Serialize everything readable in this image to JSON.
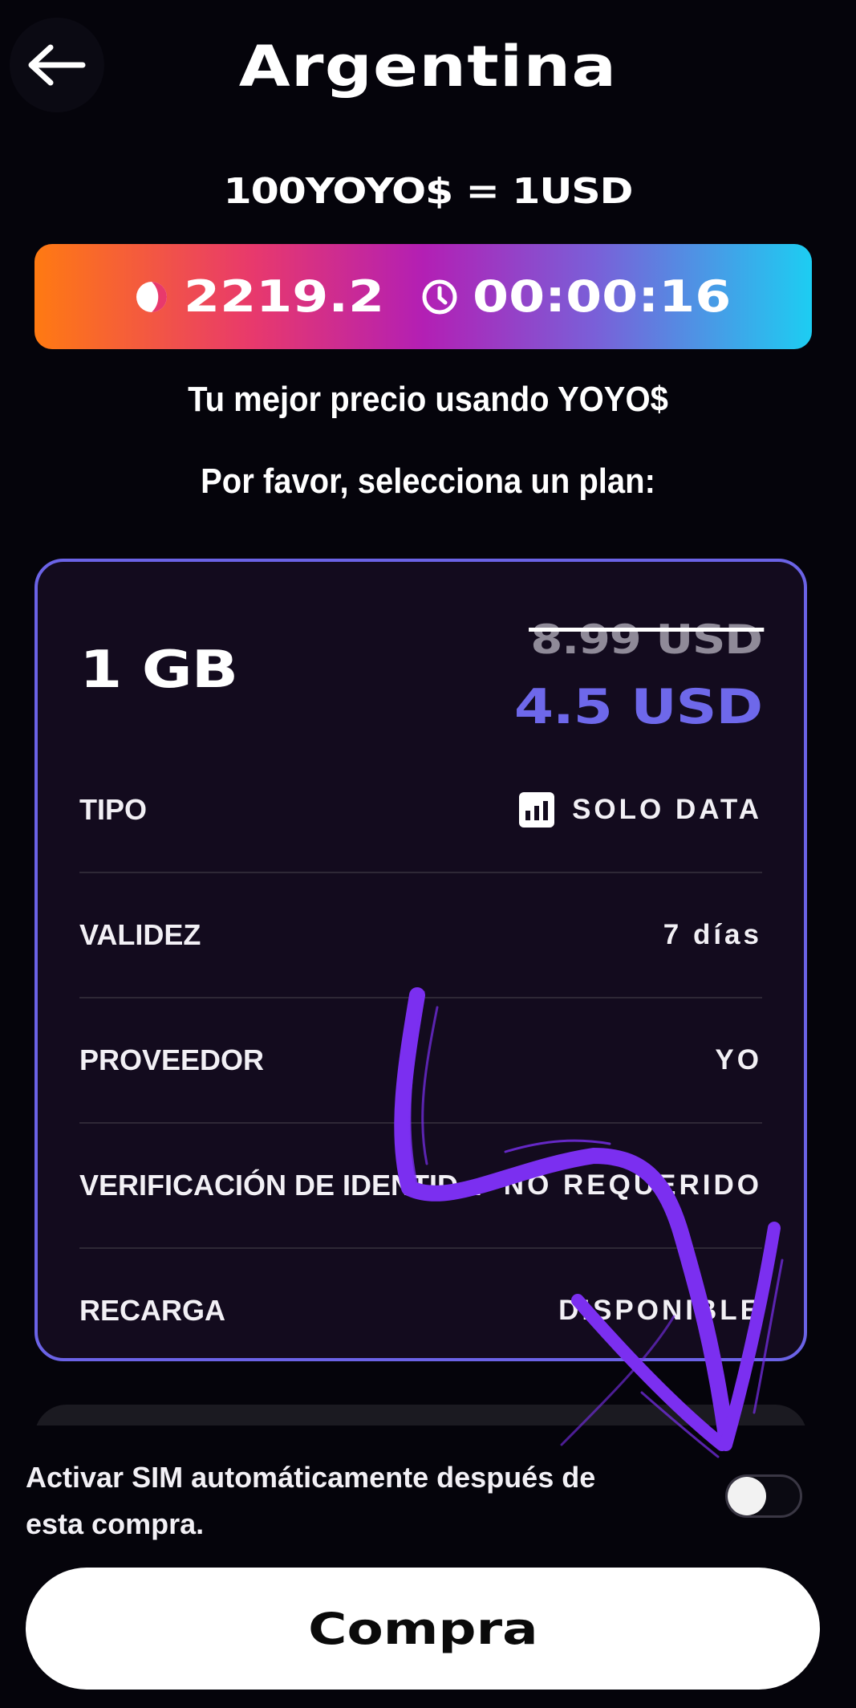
{
  "header": {
    "title": "Argentina"
  },
  "exchange_rate": "100YOYO$ = 1USD",
  "banner": {
    "balance": "2219.2",
    "timer": "00:00:16"
  },
  "subtitles": {
    "best_price": "Tu mejor precio usando YOYO$",
    "select_plan": "Por favor, selecciona un plan:"
  },
  "plan": {
    "size": "1 GB",
    "old_price": "8.99 USD",
    "new_price": "4.5 USD",
    "rows": [
      {
        "label": "TIPO",
        "value": "SOLO DATA"
      },
      {
        "label": "VALIDEZ",
        "value": "7 días"
      },
      {
        "label": "PROVEEDOR",
        "value": "YO"
      },
      {
        "label": "VERIFICACIÓN DE IDENTID...",
        "value": "NO REQUERIDO"
      },
      {
        "label": "RECARGA",
        "value": "DISPONIBLE"
      }
    ]
  },
  "auto_activate": {
    "label": "Activar SIM automáticamente después de esta compra.",
    "enabled": false
  },
  "buy_button": {
    "label": "Compra"
  },
  "colors": {
    "background": "#05040b",
    "accent": "#6e68ea",
    "annotation": "#7b2ff0"
  },
  "icons": {
    "back": "arrow-left-icon",
    "balance": "coin-icon",
    "timer": "clock-icon",
    "type": "bar-chart-icon"
  }
}
